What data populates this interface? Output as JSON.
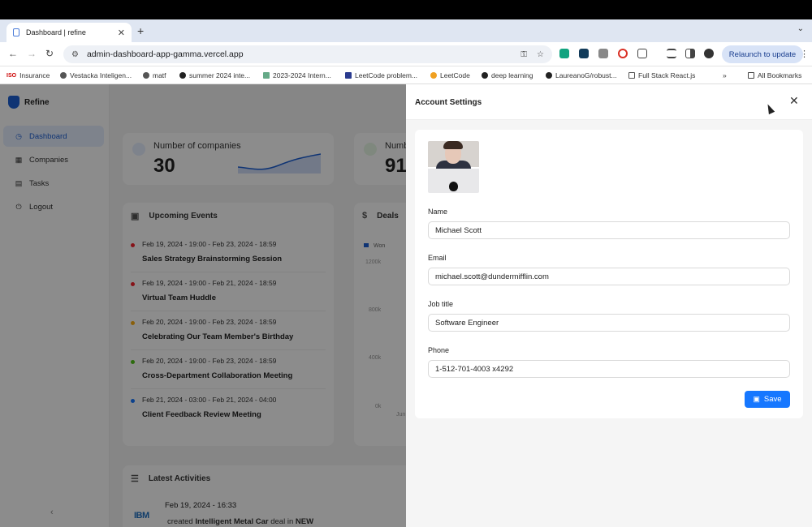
{
  "browser": {
    "tab_title": "Dashboard | refine",
    "new_tab_label": "+",
    "url": "admin-dashboard-app-gamma.vercel.app",
    "relaunch_label": "Relaunch to update",
    "bookmarks": [
      "Insurance",
      "Vestacka Inteligen...",
      "matf",
      "summer 2024 inte...",
      "2023-2024 Intern...",
      "LeetCode problem...",
      "LeetCode",
      "deep learning",
      "LaureanoG/robust...",
      "Full Stack React.js"
    ],
    "all_bookmarks": "All Bookmarks"
  },
  "app": {
    "brand": "Refine",
    "menu": [
      {
        "label": "Dashboard",
        "icon": "dashboard-icon"
      },
      {
        "label": "Companies",
        "icon": "shop-icon"
      },
      {
        "label": "Tasks",
        "icon": "tasks-icon"
      },
      {
        "label": "Logout",
        "icon": "logout-icon"
      }
    ]
  },
  "dashboard": {
    "kpis": [
      {
        "label": "Number of companies",
        "value": "30"
      },
      {
        "label": "Numb",
        "value": "91"
      }
    ],
    "events": {
      "title": "Upcoming Events",
      "items": [
        {
          "date": "Feb 19, 2024 - 19:00 - Feb 23, 2024 - 18:59",
          "title": "Sales Strategy Brainstorming Session",
          "color": "#f5222d"
        },
        {
          "date": "Feb 19, 2024 - 19:00 - Feb 21, 2024 - 18:59",
          "title": "Virtual Team Huddle",
          "color": "#f5222d"
        },
        {
          "date": "Feb 20, 2024 - 19:00 - Feb 23, 2024 - 18:59",
          "title": "Celebrating Our Team Member's Birthday",
          "color": "#faad14"
        },
        {
          "date": "Feb 20, 2024 - 19:00 - Feb 23, 2024 - 18:59",
          "title": "Cross-Department Collaboration Meeting",
          "color": "#52c41a"
        },
        {
          "date": "Feb 21, 2024 - 03:00 - Feb 21, 2024 - 04:00",
          "title": "Client Feedback Review Meeting",
          "color": "#1677ff"
        }
      ]
    },
    "deals": {
      "title": "Deals",
      "legend": "Won",
      "y_ticks": [
        "1200k",
        "800k",
        "400k",
        "0k"
      ],
      "x_tick": "Jun"
    },
    "activities": {
      "title": "Latest Activities",
      "logo": "IBM",
      "date": "Feb 19, 2024 - 16:33",
      "text_pre": "created",
      "deal": "Intelligent Metal Car",
      "text_mid": "deal in",
      "stage": "NEW"
    }
  },
  "drawer": {
    "title": "Account Settings",
    "fields": [
      {
        "label": "Name",
        "value": "Michael Scott"
      },
      {
        "label": "Email",
        "value": "michael.scott@dundermifflin.com"
      },
      {
        "label": "Job title",
        "value": "Software Engineer"
      },
      {
        "label": "Phone",
        "value": "1-512-701-4003 x4292"
      }
    ],
    "save_label": "Save"
  }
}
